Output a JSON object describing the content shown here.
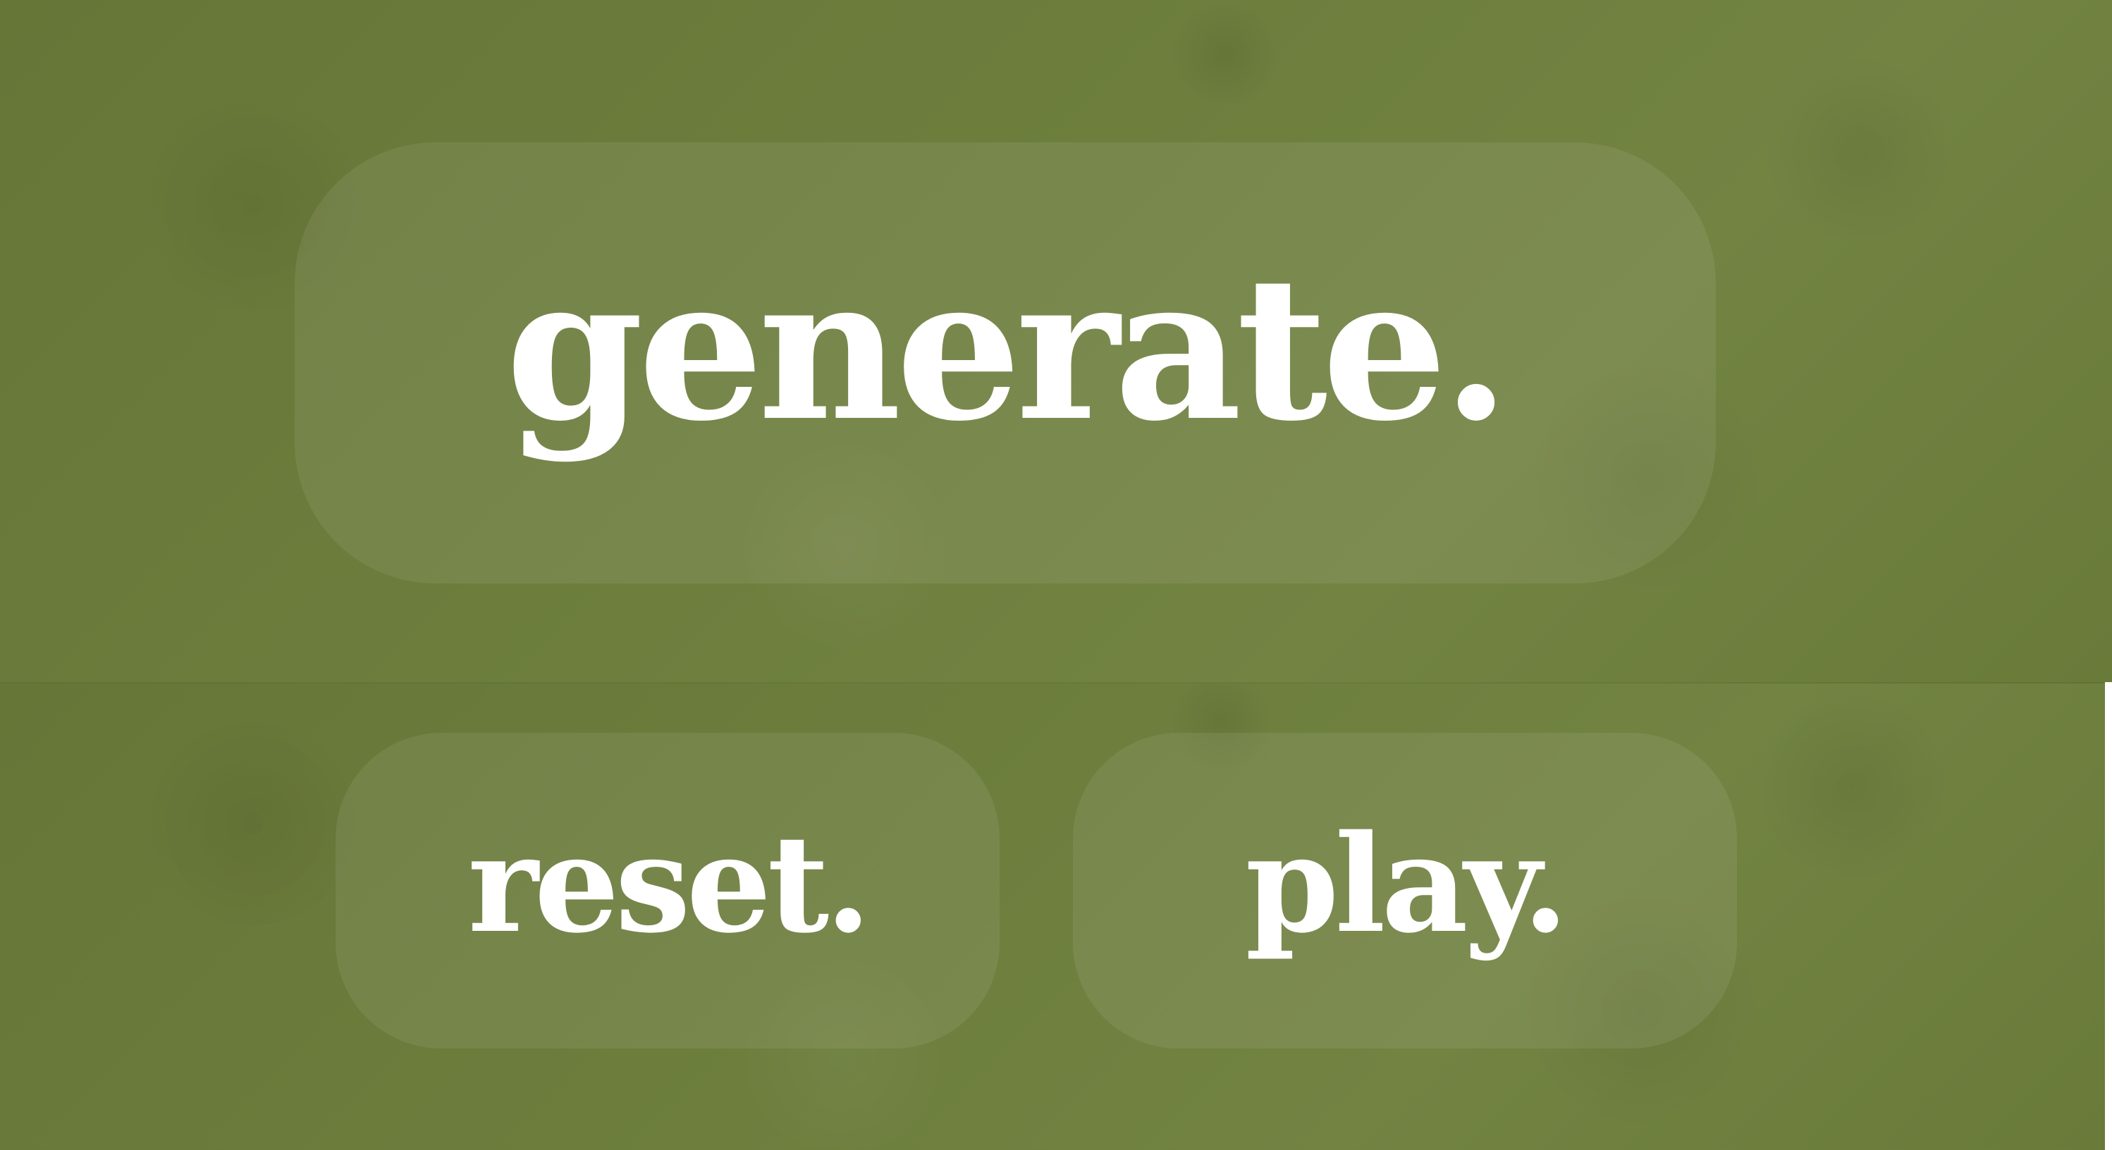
{
  "colors": {
    "background": "#6b7c3b",
    "button_fill": "rgba(255,255,255,0.08)",
    "text": "#ffffff"
  },
  "buttons": {
    "generate": "generate.",
    "reset": "reset.",
    "play": "play."
  }
}
